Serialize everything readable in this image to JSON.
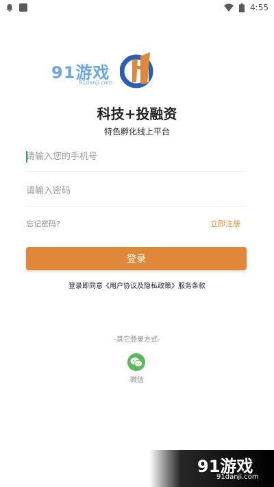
{
  "status_bar": {
    "time": "4:55",
    "left_icons": [
      "notification-icon",
      "app-icon"
    ],
    "right_icons": [
      "wifi-icon",
      "battery-icon"
    ]
  },
  "logo": {
    "text": "91游戏",
    "sub": "91danji.com"
  },
  "header": {
    "title": "科技+投融资",
    "subtitle": "特色孵化线上平台"
  },
  "form": {
    "phone_placeholder": "请输入您的手机号",
    "password_placeholder": "请输入密码",
    "forgot_label": "忘记密码?",
    "register_label": "立即注册",
    "login_label": "登录"
  },
  "terms": {
    "prefix": "登录即同意",
    "link": "《用户协议及隐私政策》",
    "suffix": "服务条款"
  },
  "other_login": {
    "label": "-其它登录方式-",
    "wechat_label": "微信"
  },
  "watermark": {
    "big": "91游戏",
    "small": "91danji.com"
  },
  "colors": {
    "accent": "#e0883a",
    "wechat": "#5cb85c",
    "logo_blue": "#6aa8e8"
  }
}
